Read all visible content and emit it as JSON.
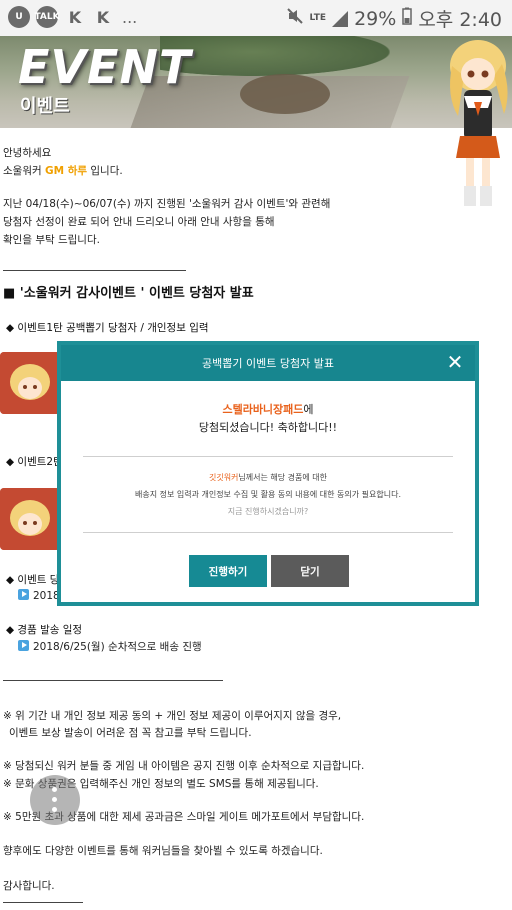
{
  "status_bar": {
    "app_icons": [
      "U",
      "TALK",
      "K",
      "K"
    ],
    "more": "...",
    "network": "LTE",
    "battery": "29%",
    "time": "오후 2:40"
  },
  "banner": {
    "title": "EVENT",
    "subtitle": "이벤트"
  },
  "intro": {
    "greeting": "안녕하세요",
    "from_prefix": "소울워커",
    "gm_name": "GM 하루",
    "from_suffix": "입니다.",
    "line1": "지난 04/18(수)~06/07(수) 까지 진행된 '소울워커 감사 이벤트'와 관련해",
    "line2": "당첨자 선정이 완료 되어 안내 드리오니 아래 안내 사항을 통해",
    "line3": "확인을 부탁 드립니다."
  },
  "section_heading": "■ '소울워커 감사이벤트 ' 이벤트 당첨자 발표",
  "event1": "◆ 이벤트1탄 공백뽑기 당첨자 / 개인정보 입력",
  "event2_partial": "◆ 이벤트2탄",
  "event_partial": "◆ 이벤트 당",
  "event_partial_sub": "2018",
  "shipping": {
    "heading": "◆ 경품 발송 일정",
    "detail": "2018/6/25(월) 순차적으로 배송 진행"
  },
  "notes": {
    "n1_line1": "※ 위 기간 내 개인 정보 제공 동의 + 개인 정보 제공이 이루어지지 않을 경우,",
    "n1_line2": "이벤트 보상 발송이 어려운 점 꼭 참고를 부탁 드립니다.",
    "n2": "※ 당첨되신 워커 분들 중 게임 내 아이템은 공지 진행 이후 순차적으로 지급합니다.",
    "n3": "※ 문화 상품권은 입력해주신 개인 정보의 별도 SMS를 통해 제공됩니다.",
    "n4": "※ 5만원 초과 상품에 대한 제세 공과금은 스마일 게이트 메가포트에서 부담합니다.",
    "closing": "향후에도 다양한 이벤트를 통해 워커님들을 찾아뵐 수 있도록 하겠습니다.",
    "thanks": "감사합니다."
  },
  "modal": {
    "title": "공백뽑기 이벤트 당첨자 발표",
    "close_symbol": "✕",
    "prize": "스텔라바니장패드",
    "prize_suffix": "에",
    "congrats": "당첨되셨습니다! 축하합니다!!",
    "user_name": "깃깃워커",
    "info_line1_suffix": "님께서는 해당 경품에 대한",
    "info_line2": "배송지 정보 입력과 개인정보 수집 및 활용 동의 내용에 대한 동의가 필요합니다.",
    "question": "지금 진행하시겠습니까?",
    "proceed_button": "진행하기",
    "close_button": "닫기"
  },
  "colors": {
    "accent_teal": "#17868f",
    "prize_orange": "#e9621c",
    "gm_orange": "#f0a000"
  }
}
